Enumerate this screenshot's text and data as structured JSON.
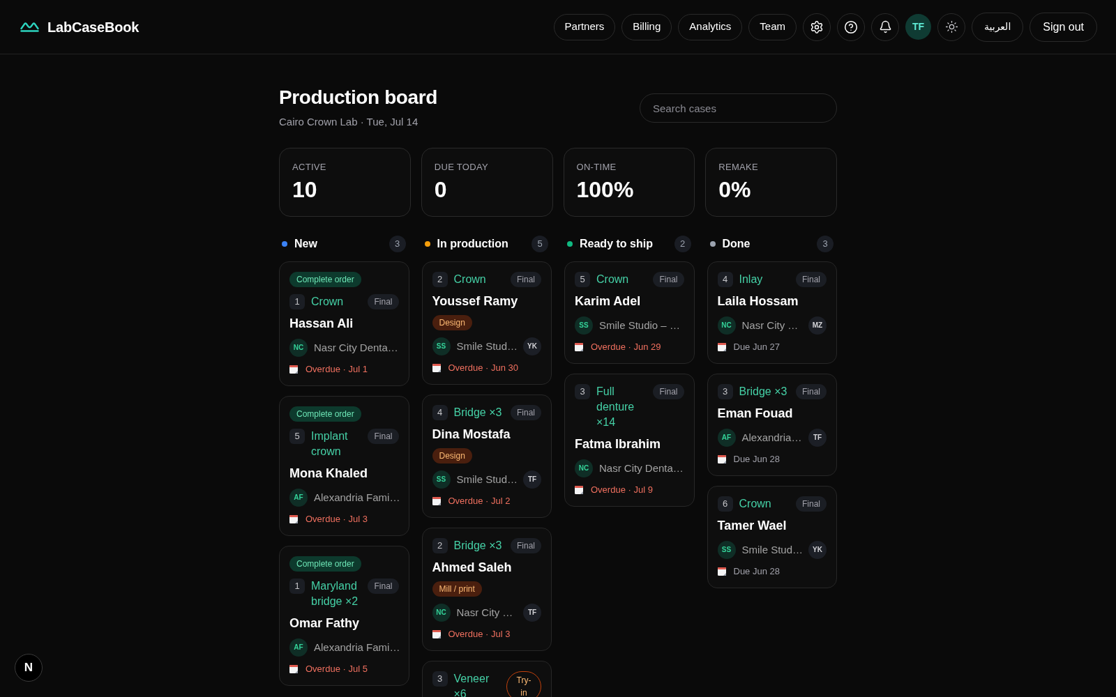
{
  "header": {
    "brand": "LabCaseBook",
    "nav_links": [
      "Partners",
      "Billing",
      "Analytics",
      "Team"
    ],
    "user_initials": "TF",
    "language_button": "العربية",
    "sign_out_button": "Sign out"
  },
  "page": {
    "title": "Production board",
    "subtitle": "Cairo Crown Lab · Tue, Jul 14",
    "search": {
      "placeholder": "Search cases"
    }
  },
  "stats": [
    {
      "label": "ACTIVE",
      "value": "10"
    },
    {
      "label": "DUE TODAY",
      "value": "0"
    },
    {
      "label": "ON-TIME",
      "value": "100%"
    },
    {
      "label": "REMAKE",
      "value": "0%"
    }
  ],
  "columns": [
    {
      "name": "New",
      "count": "3",
      "color": "#3b82f6",
      "cards": [
        {
          "action": "Complete order",
          "units": "1",
          "product": "Crown",
          "phase": {
            "label": "Final",
            "kind": "final"
          },
          "patient": "Hassan Ali",
          "clinic": {
            "initials": "NC",
            "name": "Nasr City Denta…"
          },
          "due": {
            "text": "Overdue · Jul 1",
            "overdue": true
          }
        },
        {
          "action": "Complete order",
          "units": "5",
          "product": "Implant crown",
          "phase": {
            "label": "Final",
            "kind": "final"
          },
          "patient": "Mona Khaled",
          "clinic": {
            "initials": "AF",
            "name": "Alexandria Fami…"
          },
          "due": {
            "text": "Overdue · Jul 3",
            "overdue": true
          }
        },
        {
          "action": "Complete order",
          "units": "1",
          "product": "Maryland bridge ×2",
          "phase": {
            "label": "Final",
            "kind": "final"
          },
          "patient": "Omar Fathy",
          "clinic": {
            "initials": "AF",
            "name": "Alexandria Fami…"
          },
          "due": {
            "text": "Overdue · Jul 5",
            "overdue": true
          }
        }
      ]
    },
    {
      "name": "In production",
      "count": "5",
      "color": "#f59e0b",
      "cards": [
        {
          "units": "2",
          "product": "Crown",
          "phase": {
            "label": "Final",
            "kind": "final"
          },
          "patient": "Youssef Ramy",
          "stage": "Design",
          "clinic": {
            "initials": "SS",
            "name": "Smile Stud…"
          },
          "technician": "YK",
          "due": {
            "text": "Overdue · Jun 30",
            "overdue": true
          }
        },
        {
          "units": "4",
          "product": "Bridge ×3",
          "phase": {
            "label": "Final",
            "kind": "final"
          },
          "patient": "Dina Mostafa",
          "stage": "Design",
          "clinic": {
            "initials": "SS",
            "name": "Smile Stud…"
          },
          "technician": "TF",
          "due": {
            "text": "Overdue · Jul 2",
            "overdue": true
          }
        },
        {
          "units": "2",
          "product": "Bridge ×3",
          "phase": {
            "label": "Final",
            "kind": "final"
          },
          "patient": "Ahmed Saleh",
          "stage": "Mill / print",
          "clinic": {
            "initials": "NC",
            "name": "Nasr City …"
          },
          "technician": "TF",
          "due": {
            "text": "Overdue · Jul 3",
            "overdue": true
          }
        },
        {
          "units": "3",
          "product": "Veneer ×6",
          "phase": {
            "label": "Try-in",
            "kind": "try_in"
          }
        }
      ]
    },
    {
      "name": "Ready to ship",
      "count": "2",
      "color": "#10b981",
      "cards": [
        {
          "units": "5",
          "product": "Crown",
          "phase": {
            "label": "Final",
            "kind": "final"
          },
          "patient": "Karim Adel",
          "clinic": {
            "initials": "SS",
            "name": "Smile Studio – …"
          },
          "due": {
            "text": "Overdue · Jun 29",
            "overdue": true
          }
        },
        {
          "units": "3",
          "product": "Full denture ×14",
          "phase": {
            "label": "Final",
            "kind": "final"
          },
          "patient": "Fatma Ibrahim",
          "clinic": {
            "initials": "NC",
            "name": "Nasr City Denta…"
          },
          "due": {
            "text": "Overdue · Jul 9",
            "overdue": true
          }
        }
      ]
    },
    {
      "name": "Done",
      "count": "3",
      "color": "#9ca3af",
      "cards": [
        {
          "units": "4",
          "product": "Inlay",
          "phase": {
            "label": "Final",
            "kind": "final"
          },
          "patient": "Laila Hossam",
          "clinic": {
            "initials": "NC",
            "name": "Nasr City …"
          },
          "technician": "MZ",
          "due": {
            "text": "Due Jun 27",
            "overdue": false
          }
        },
        {
          "units": "3",
          "product": "Bridge ×3",
          "phase": {
            "label": "Final",
            "kind": "final"
          },
          "patient": "Eman Fouad",
          "clinic": {
            "initials": "AF",
            "name": "Alexandria…"
          },
          "technician": "TF",
          "due": {
            "text": "Due Jun 28",
            "overdue": false
          }
        },
        {
          "units": "6",
          "product": "Crown",
          "phase": {
            "label": "Final",
            "kind": "final"
          },
          "patient": "Tamer Wael",
          "clinic": {
            "initials": "SS",
            "name": "Smile Stud…"
          },
          "technician": "YK",
          "due": {
            "text": "Due Jun 28",
            "overdue": false
          }
        }
      ]
    }
  ],
  "dev_indicator": {
    "label": "N"
  }
}
